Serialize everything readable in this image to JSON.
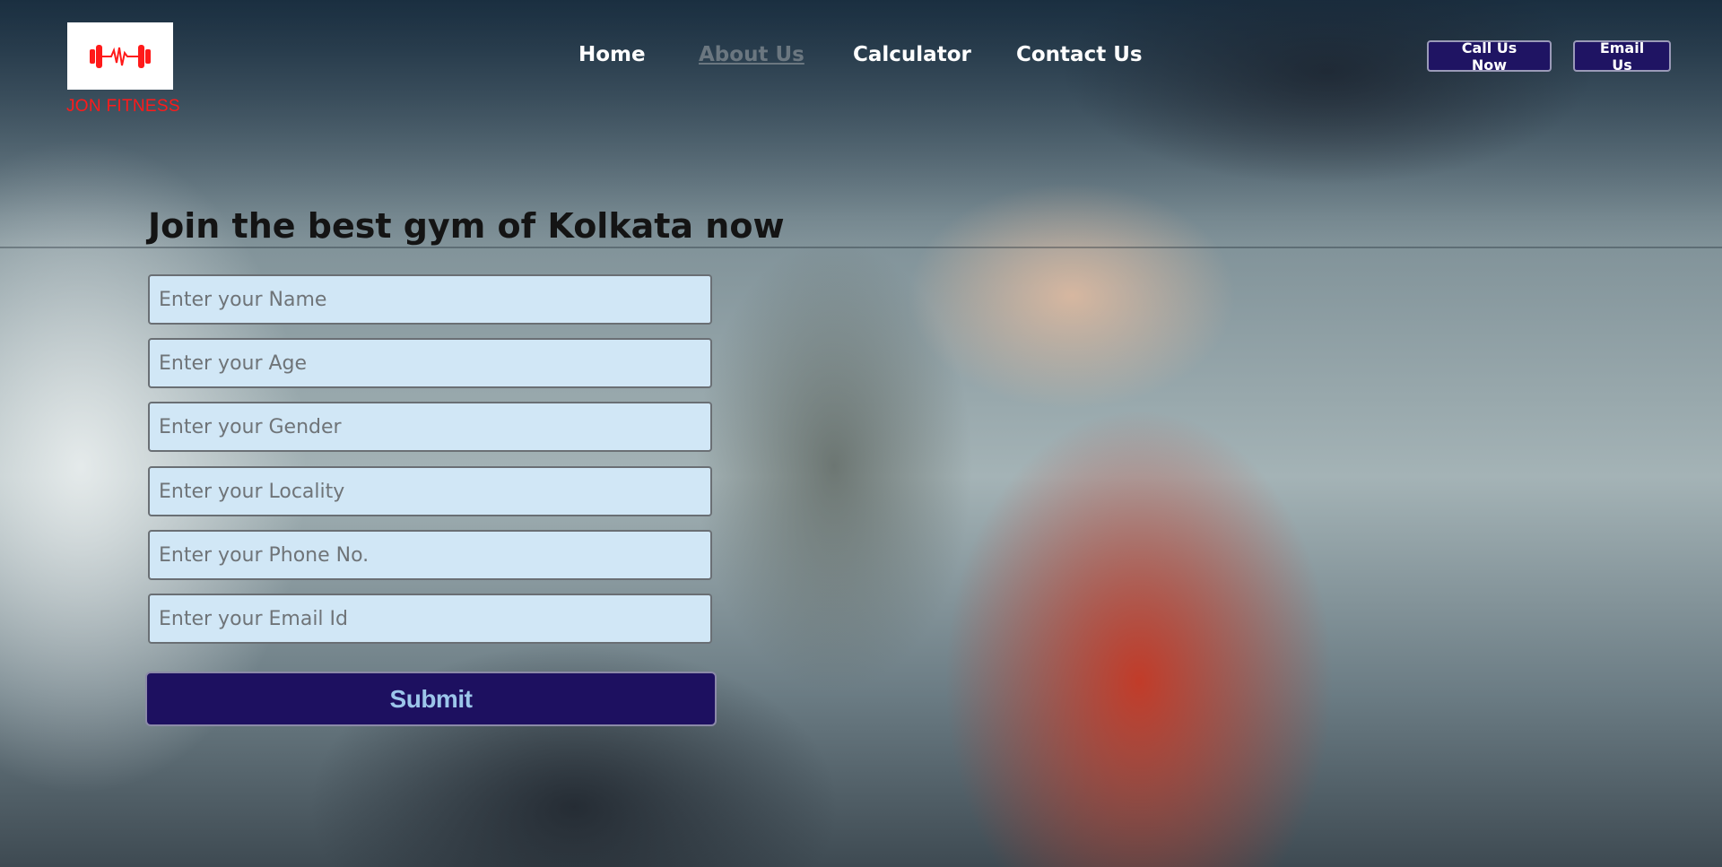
{
  "brand": {
    "name": "JON FITNESS",
    "logo_icon": "dumbbell-heartbeat-icon",
    "logo_color": "#ff1a1a"
  },
  "nav": {
    "items": [
      {
        "label": "Home",
        "active": false
      },
      {
        "label": "About Us",
        "active": true
      },
      {
        "label": "Calculator",
        "active": false
      },
      {
        "label": "Contact Us",
        "active": false
      }
    ]
  },
  "header_actions": {
    "call_label": "Call Us Now",
    "email_label": "Email Us"
  },
  "form": {
    "title": "Join the best gym of Kolkata now",
    "name_placeholder": "Enter your Name",
    "age_placeholder": "Enter your Age",
    "gender_placeholder": "Enter your Gender",
    "locality_placeholder": "Enter your Locality",
    "phone_placeholder": "Enter your Phone No.",
    "email_placeholder": "Enter your Email Id",
    "submit_label": "Submit"
  },
  "colors": {
    "button_bg": "#1f1463",
    "field_bg": "#d1e7f6",
    "submit_text": "#9cc6ea"
  }
}
